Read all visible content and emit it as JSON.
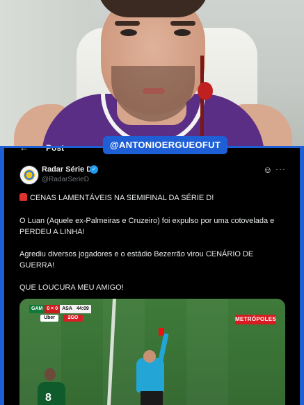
{
  "webcam": {
    "watermark": "@ANTONIOERGUEOFUT"
  },
  "header": {
    "back_icon": "arrow-left-icon",
    "title": "Post"
  },
  "tweet": {
    "account_name": "Radar Série D",
    "handle": "@RadarSerieD",
    "verified": true,
    "paragraphs": [
      "CENAS LAMENTÁVEIS NA SEMIFINAL DA SÉRIE D!",
      "O Luan (Aquele ex-Palmeiras e Cruzeiro) foi expulso por uma cotovelada e PERDEU A LINHA!",
      "Agrediu diversos jogadores e o estádio Bezerrão virou CENÁRIO DE GUERRA!",
      "QUE LOUCURA MEU AMIGO!"
    ],
    "icons": {
      "grok": "grok-icon",
      "more": "more-icon",
      "siren": "police-light-icon"
    }
  },
  "media": {
    "scoreboard": {
      "team1": "GAM",
      "score": "0 × 0",
      "team2": "ASA",
      "time": "44:09"
    },
    "sponsors": [
      "Uber",
      "2GO"
    ],
    "broadcaster": "METRÓPOLES",
    "player_number": "8"
  },
  "colors": {
    "accent_frame": "#1f5fd6",
    "verified": "#1d9bf0",
    "background": "#000000"
  }
}
